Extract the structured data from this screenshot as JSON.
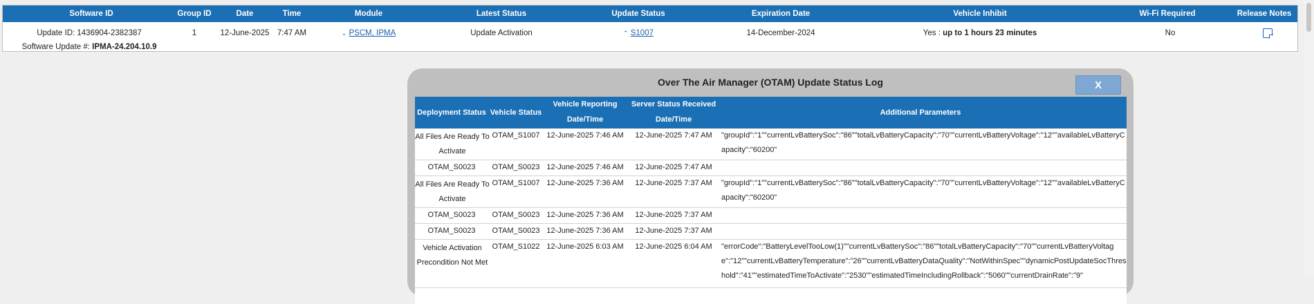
{
  "top_table": {
    "headers": {
      "software_id": "Software ID",
      "group_id": "Group ID",
      "date": "Date",
      "time": "Time",
      "module": "Module",
      "latest_status": "Latest Status",
      "update_status": "Update Status",
      "expiration_date": "Expiration Date",
      "vehicle_inhibit": "Vehicle Inhibit",
      "wifi_required": "Wi-Fi Required",
      "release_notes": "Release Notes"
    },
    "row": {
      "update_id": "Update ID: 1436904-2382387",
      "software_update_label": "Software Update #:",
      "software_update_value": "IPMA-24.204.10.9",
      "group_id": "1",
      "date": "12-June-2025",
      "time": "7:47 AM",
      "module": "PSCM, IPMA",
      "latest_status": "Update Activation",
      "update_status": "S1007",
      "expiration_date": "14-December-2024",
      "vehicle_inhibit_label": "Yes :",
      "vehicle_inhibit_value": "up to 1 hours 23 minutes",
      "wifi_required": "No",
      "release_notes_icon": "note-icon"
    }
  },
  "modal": {
    "title": "Over The Air Manager (OTAM) Update Status Log",
    "close_label": "X",
    "headers": {
      "deployment_status": "Deployment Status",
      "vehicle_status": "Vehicle Status",
      "vehicle_reporting_1": "Vehicle Reporting",
      "vehicle_reporting_2": "Date/Time",
      "server_status_1": "Server Status Received",
      "server_status_2": "Date/Time",
      "additional_parameters": "Additional Parameters"
    },
    "rows": [
      {
        "deployment": "All Files Are Ready To Activate",
        "vehicle_status": "OTAM_S1007",
        "vehicle_reporting": "12-June-2025 7:46 AM",
        "server_received": "12-June-2025 7:47 AM",
        "params": "\"groupId\":\"1\"\"currentLvBatterySoc\":\"86\"\"totalLvBatteryCapacity\":\"70\"\"currentLvBatteryVoltage\":\"12\"\"availableLvBatteryCapacity\":\"60200\""
      },
      {
        "deployment": "OTAM_S0023",
        "vehicle_status": "OTAM_S0023",
        "vehicle_reporting": "12-June-2025 7:46 AM",
        "server_received": "12-June-2025 7:47 AM",
        "params": ""
      },
      {
        "deployment": "All Files Are Ready To Activate",
        "vehicle_status": "OTAM_S1007",
        "vehicle_reporting": "12-June-2025 7:36 AM",
        "server_received": "12-June-2025 7:37 AM",
        "params": "\"groupId\":\"1\"\"currentLvBatterySoc\":\"86\"\"totalLvBatteryCapacity\":\"70\"\"currentLvBatteryVoltage\":\"12\"\"availableLvBatteryCapacity\":\"60200\""
      },
      {
        "deployment": "OTAM_S0023",
        "vehicle_status": "OTAM_S0023",
        "vehicle_reporting": "12-June-2025 7:36 AM",
        "server_received": "12-June-2025 7:37 AM",
        "params": ""
      },
      {
        "deployment": "OTAM_S0023",
        "vehicle_status": "OTAM_S0023",
        "vehicle_reporting": "12-June-2025 7:36 AM",
        "server_received": "12-June-2025 7:37 AM",
        "params": ""
      },
      {
        "deployment": "Vehicle Activation Precondition Not Met",
        "vehicle_status": "OTAM_S1022",
        "vehicle_reporting": "12-June-2025 6:03 AM",
        "server_received": "12-June-2025 6:04 AM",
        "params": "\"errorCode\":\"BatteryLevelTooLow(1)\"\"currentLvBatterySoc\":\"86\"\"totalLvBatteryCapacity\":\"70\"\"currentLvBatteryVoltage\":\"12\"\"currentLvBatteryTemperature\":\"26\"\"currentLvBatteryDataQuality\":\"NotWithinSpec\"\"dynamicPostUpdateSocThreshold\":\"41\"\"estimatedTimeToActivate\":\"2530\"\"estimatedTimeIncludingRollback\":\"5060\"\"currentDrainRate\":\"9\""
      }
    ]
  }
}
